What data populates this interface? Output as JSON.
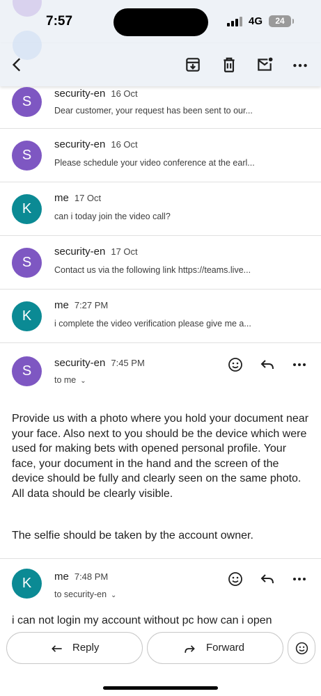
{
  "status_bar": {
    "time": "7:57",
    "network": "4G",
    "battery": "24"
  },
  "toolbar": {
    "icons": [
      "back-arrow-icon",
      "archive-icon",
      "trash-icon",
      "mark-unread-icon",
      "more-icon"
    ]
  },
  "colors": {
    "purple_avatar": "#7e57c2",
    "teal_avatar": "#0b8a94",
    "toolbar_bg": "#eef2f7"
  },
  "thread": [
    {
      "initial": "S",
      "sender": "security-en",
      "date": "16 Oct",
      "snippet": "Dear customer, your request has been sent to our...",
      "color": "purple"
    },
    {
      "initial": "S",
      "sender": "security-en",
      "date": "16 Oct",
      "snippet": "Please schedule your video conference at the earl...",
      "color": "purple"
    },
    {
      "initial": "K",
      "sender": "me",
      "date": "17 Oct",
      "snippet": "can i today join the video call?",
      "color": "teal"
    },
    {
      "initial": "S",
      "sender": "security-en",
      "date": "17 Oct",
      "snippet": "Contact us via the following link https://teams.live...",
      "color": "purple"
    },
    {
      "initial": "K",
      "sender": "me",
      "date": "7:27 PM",
      "snippet": "i complete the video verification please give me a...",
      "color": "teal"
    }
  ],
  "message_open": {
    "initial": "S",
    "sender": "security-en",
    "time": "7:45 PM",
    "to": "to me",
    "body_p1": "Provide us with a photo where you hold your document near your face. Also next to you should be the device which were used for making bets with opened personal profile. Your face, your document in the hand and the screen of the device should be fully and clearly seen on the same photo. All data should be clearly visible.",
    "body_p2": "The selfie should be taken by the account owner."
  },
  "message_reply": {
    "initial": "K",
    "sender": "me",
    "time": "7:48 PM",
    "to": "to security-en",
    "body_p1": "i can not login my account without pc how can i open"
  },
  "bottom_bar": {
    "reply_label": "Reply",
    "forward_label": "Forward"
  }
}
